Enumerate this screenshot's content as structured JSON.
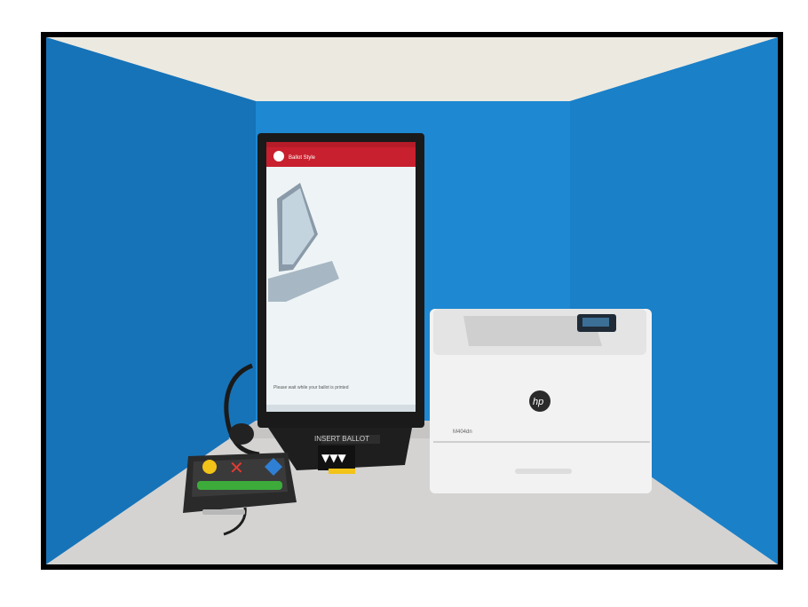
{
  "scene": {
    "subject": "accessible voting booth",
    "colors": {
      "booth_wall": "#1e88d2",
      "booth_wall_dark": "#1673b8",
      "ceiling": "#ece9e0",
      "desk": "#d4d3d2",
      "frame": "#000000",
      "tablet_bezel": "#1a1a1a",
      "tablet_header": "#c8202e",
      "printer_body": "#f2f2f2",
      "keypad_body": "#2a2a2a"
    },
    "tablet": {
      "header_text": "Ballot Style",
      "footer_prompt": "Please wait while your ballot is printed"
    },
    "stand": {
      "label": "INSERT BALLOT",
      "arrow_glyph": "▼▼▼"
    },
    "printer": {
      "brand": "hp",
      "model_label": "M404dn"
    },
    "keypad": {
      "buttons": [
        {
          "shape": "circle",
          "color": "#f2c318"
        },
        {
          "shape": "x",
          "color": "#e53a32"
        },
        {
          "shape": "diamond",
          "color": "#2f7fd4"
        },
        {
          "shape": "bar",
          "color": "#3cab3a"
        }
      ]
    }
  }
}
